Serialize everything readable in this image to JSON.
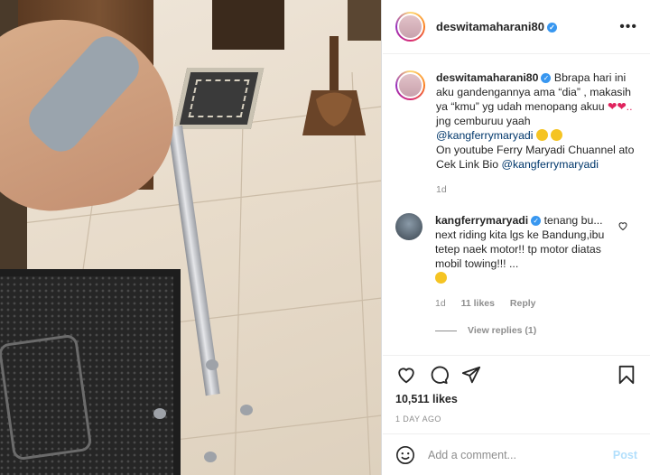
{
  "photo": {
    "alt_icon": "photo"
  },
  "header": {
    "username": "deswitamaharani80",
    "verified_icon": "verified-badge-icon",
    "more_icon": "more-options-icon",
    "more_label": "•••"
  },
  "caption": {
    "username": "deswitamaharani80",
    "line1": "Bbrapa hari ini aku gandengannya ama “dia” , makasih ya “kmu” yg udah menopang akuu",
    "hearts": "❤❤..",
    "line2": "jng cemburuu yaah",
    "mention1": "@kangferrymaryadi",
    "line3": "On youtube Ferry Maryadi Chuannel ato Cek Link Bio",
    "mention2": "@kangferrymaryadi",
    "time": "1d"
  },
  "comment": {
    "username": "kangferrymaryadi",
    "text": "tenang bu... next riding kita lgs ke Bandung,ibu tetep naek motor!! tp motor diatas mobil towing!!! ...",
    "time": "1d",
    "likes": "11 likes",
    "reply_label": "Reply",
    "view_replies": "View replies (1)"
  },
  "actions": {
    "like_icon": "heart-icon",
    "comment_icon": "comment-icon",
    "share_icon": "share-icon",
    "save_icon": "bookmark-icon"
  },
  "likes": "10,511 likes",
  "date": "1 DAY AGO",
  "add_comment": {
    "placeholder": "Add a comment...",
    "post_label": "Post",
    "emoji_icon": "emoji-icon"
  },
  "colors": {
    "link": "#00376b",
    "verified": "#3897f0",
    "post_disabled": "#b2dffc",
    "muted": "#8e8e8e"
  }
}
